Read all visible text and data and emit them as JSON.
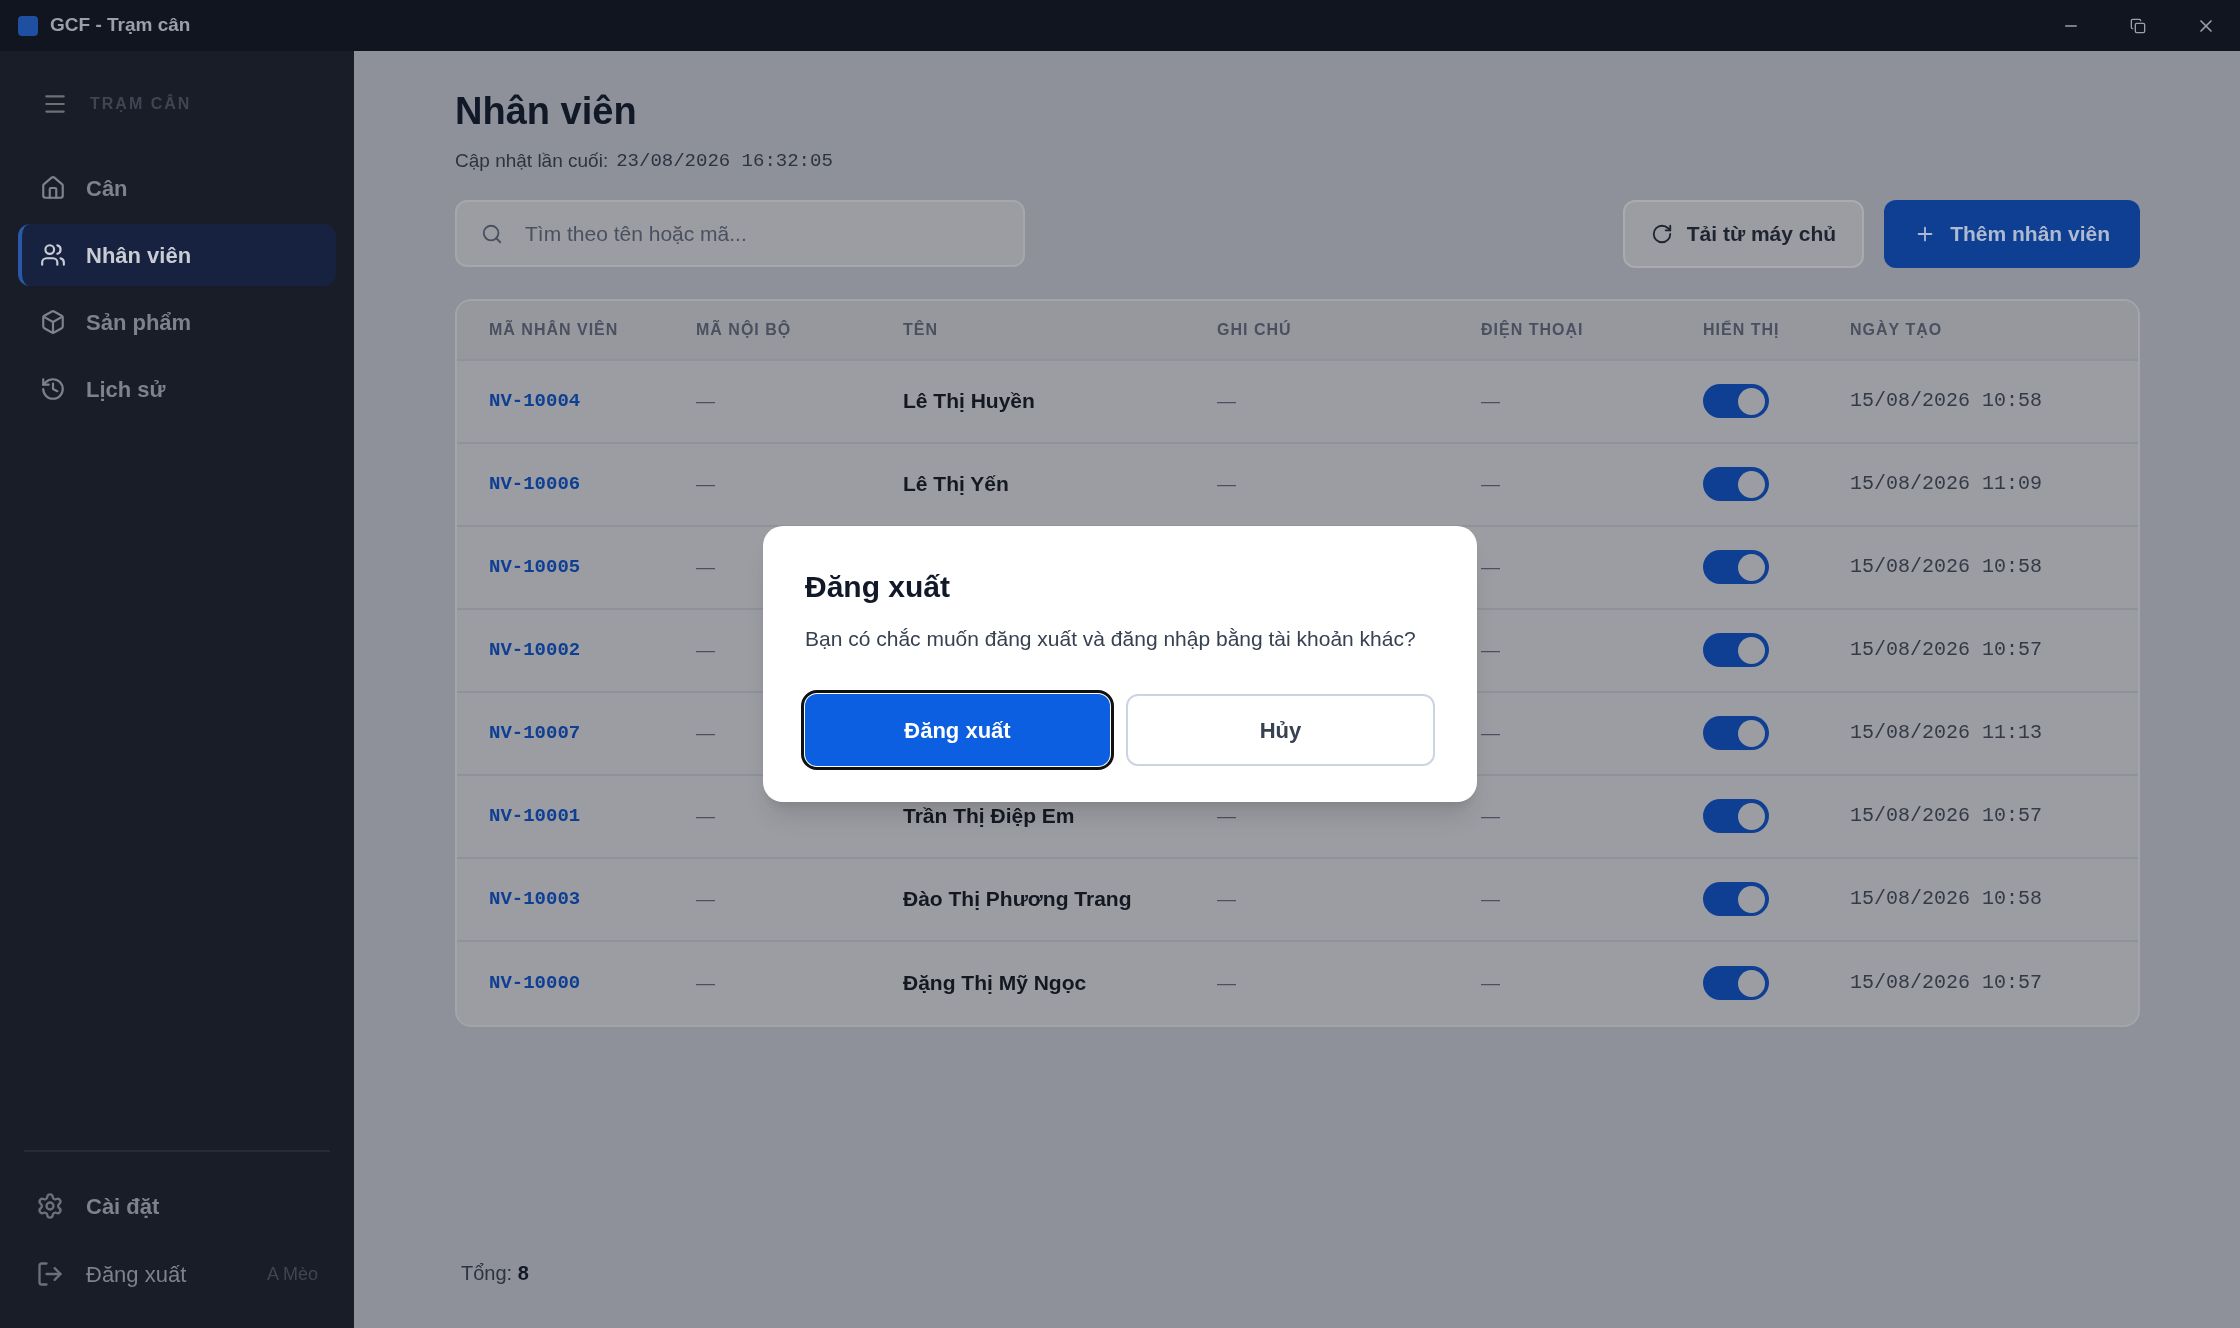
{
  "window": {
    "title": "GCF - Trạm cân"
  },
  "sidebar": {
    "heading": "TRẠM CÂN",
    "items": [
      {
        "label": "Cân",
        "selected": false
      },
      {
        "label": "Nhân viên",
        "selected": true
      },
      {
        "label": "Sản phẩm",
        "selected": false
      },
      {
        "label": "Lịch sử",
        "selected": false
      }
    ],
    "footer_items": [
      {
        "label": "Cài đặt"
      },
      {
        "label": "Đăng xuất",
        "user": "A Mèo"
      }
    ]
  },
  "page": {
    "title": "Nhân viên",
    "updated_label": "Cập nhật lần cuối:",
    "updated_value": "23/08/2026 16:32:05"
  },
  "search": {
    "placeholder": "Tìm theo tên hoặc mã..."
  },
  "actions": [
    {
      "kind": "secondary",
      "label": "Tải từ máy chủ"
    },
    {
      "kind": "primary",
      "label": "Thêm nhân viên"
    }
  ],
  "table": {
    "columns": [
      "MÃ NHÂN VIÊN",
      "MÃ NỘI BỘ",
      "TÊN",
      "GHI CHÚ",
      "ĐIỆN THOẠI",
      "HIỂN THỊ",
      "NGÀY TẠO"
    ],
    "rows": [
      {
        "code": "NV-10004",
        "internal": "—",
        "name": "Lê Thị Huyền",
        "note": "—",
        "phone": "—",
        "visible": true,
        "created": "15/08/2026 10:58"
      },
      {
        "code": "NV-10006",
        "internal": "—",
        "name": "Lê Thị Yến",
        "note": "—",
        "phone": "—",
        "visible": true,
        "created": "15/08/2026 11:09"
      },
      {
        "code": "NV-10005",
        "internal": "—",
        "phone": "—",
        "visible": true,
        "created": "15/08/2026 10:58"
      },
      {
        "code": "NV-10002",
        "internal": "—",
        "phone": "—",
        "visible": true,
        "created": "15/08/2026 10:57"
      },
      {
        "code": "NV-10007",
        "internal": "—",
        "phone": "—",
        "visible": true,
        "created": "15/08/2026 11:13"
      },
      {
        "code": "NV-10001",
        "internal": "—",
        "name": "Trần Thị Điệp Em",
        "note": "—",
        "phone": "—",
        "visible": true,
        "created": "15/08/2026 10:57"
      },
      {
        "code": "NV-10003",
        "internal": "—",
        "name": "Đào Thị Phương Trang",
        "note": "—",
        "phone": "—",
        "visible": true,
        "created": "15/08/2026 10:58"
      },
      {
        "code": "NV-10000",
        "internal": "—",
        "name": "Đặng Thị Mỹ Ngọc",
        "note": "—",
        "phone": "—",
        "visible": true,
        "created": "15/08/2026 10:57"
      }
    ]
  },
  "footer": {
    "total": "Tổng: **8**"
  },
  "dialog": {
    "title": "Đăng xuất",
    "message": "Bạn có chắc muốn đăng xuất và đăng nhập bằng tài khoản khác?",
    "buttons": [
      {
        "kind": "primary",
        "label": "Đăng xuất",
        "focused": true
      },
      {
        "kind": "secondary",
        "label": "Hủy",
        "focused": false
      }
    ]
  }
}
